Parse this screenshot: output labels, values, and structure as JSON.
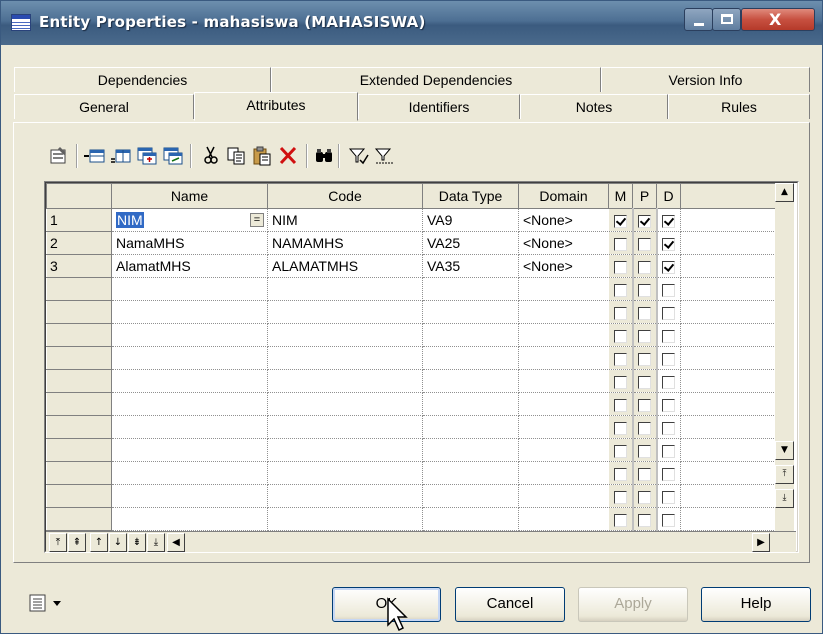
{
  "window": {
    "title": "Entity Properties - mahasiswa (MAHASISWA)",
    "controls": {
      "close_glyph": "X"
    }
  },
  "tabs": {
    "back_row": [
      "Dependencies",
      "Extended Dependencies",
      "Version Info"
    ],
    "front_row": [
      "General",
      "Attributes",
      "Identifiers",
      "Notes",
      "Rules"
    ],
    "active": "Attributes"
  },
  "toolbar": {
    "icons": [
      "properties-icon",
      "add-row-icon",
      "insert-row-icon",
      "add-attributes-icon",
      "reuse-attributes-icon",
      "cut-icon",
      "copy-icon",
      "paste-icon",
      "delete-icon",
      "find-icon",
      "filter-icon",
      "filter-settings-icon"
    ]
  },
  "grid": {
    "columns": [
      "Name",
      "Code",
      "Data Type",
      "Domain",
      "M",
      "P",
      "D"
    ],
    "rows": [
      {
        "num": "1",
        "name": "NIM",
        "code": "NIM",
        "data_type": "VA9",
        "domain": "<None>",
        "m": true,
        "p": true,
        "d": true
      },
      {
        "num": "2",
        "name": "NamaMHS",
        "code": "NAMAMHS",
        "data_type": "VA25",
        "domain": "<None>",
        "m": false,
        "p": false,
        "d": true
      },
      {
        "num": "3",
        "name": "AlamatMHS",
        "code": "ALAMATMHS",
        "data_type": "VA35",
        "domain": "<None>",
        "m": false,
        "p": false,
        "d": true
      }
    ],
    "empty_rows": 11,
    "name_ellipsis": "="
  },
  "footer": {
    "ok": "OK",
    "cancel": "Cancel",
    "apply": "Apply",
    "help": "Help"
  }
}
